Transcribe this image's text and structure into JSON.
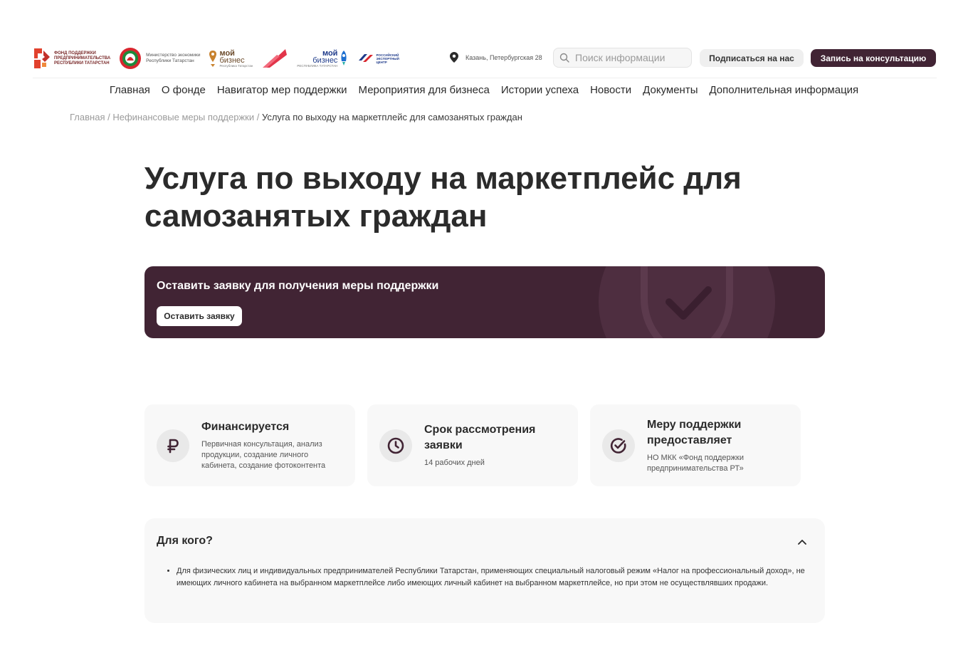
{
  "header": {
    "logos": {
      "fund": [
        "Фонд поддержки",
        "предпринимательства",
        "Республики Татарстан"
      ],
      "ministry": [
        "Министерство экономики",
        "Республики Татарстан"
      ],
      "moy_biznes": {
        "line1": "мой",
        "line2": "бизнес",
        "sub": "Республика Татарстан"
      },
      "moy_biznes_export": {
        "line1": "мой",
        "line2": "бизнес",
        "sub": "РЕСПУБЛИКА ТАТАРСТАН"
      },
      "rec": "РОССИЙСКИЙ ЭКСПОРТНЫЙ ЦЕНТР"
    },
    "location": "Казань, Петербургская 28",
    "search_placeholder": "Поиск информации",
    "subscribe_label": "Подписаться на нас",
    "consult_label": "Запись на консультацию"
  },
  "nav": {
    "items": [
      "Главная",
      "О фонде",
      "Навигатор мер поддержки",
      "Мероприятия для бизнеса",
      "Истории успеха",
      "Новости",
      "Документы",
      "Дополнительная информация"
    ]
  },
  "breadcrumb": {
    "items": [
      "Главная",
      "Нефинансовые меры поддержки"
    ],
    "current": "Услуга по выходу на маркетплейс для самозанятых граждан"
  },
  "page_title": "Услуга по выходу на маркетплейс для самозанятых граждан",
  "banner": {
    "title": "Оставить заявку для получения меры поддержки",
    "button": "Оставить заявку"
  },
  "cards": [
    {
      "icon": "ruble-icon",
      "title": "Финансируется",
      "text": "Первичная консультация, анализ продукции, создание личного кабинета, создание фотоконтента"
    },
    {
      "icon": "clock-icon",
      "title": "Срок рассмотрения заявки",
      "text": "14 рабочих дней"
    },
    {
      "icon": "check-circle-icon",
      "title": "Меру поддержки предоставляет",
      "text": "НО МКК «Фонд поддержки предпринимательства РТ»"
    }
  ],
  "accordion": {
    "title": "Для кого?",
    "items": [
      "Для физических лиц и индивидуальных предпринимателей Республики Татарстан, применяющих специальный налоговый режим «Налог на профессиональный доход», не имеющих личного кабинета на выбранном маркетплейсе либо имеющих личный кабинет на выбранном маркетплейсе, но при этом не осуществлявших продажи."
    ]
  },
  "colors": {
    "brand": "#412434",
    "card_bg": "#f8f8f8",
    "icon_bg": "#e9e9e9"
  }
}
